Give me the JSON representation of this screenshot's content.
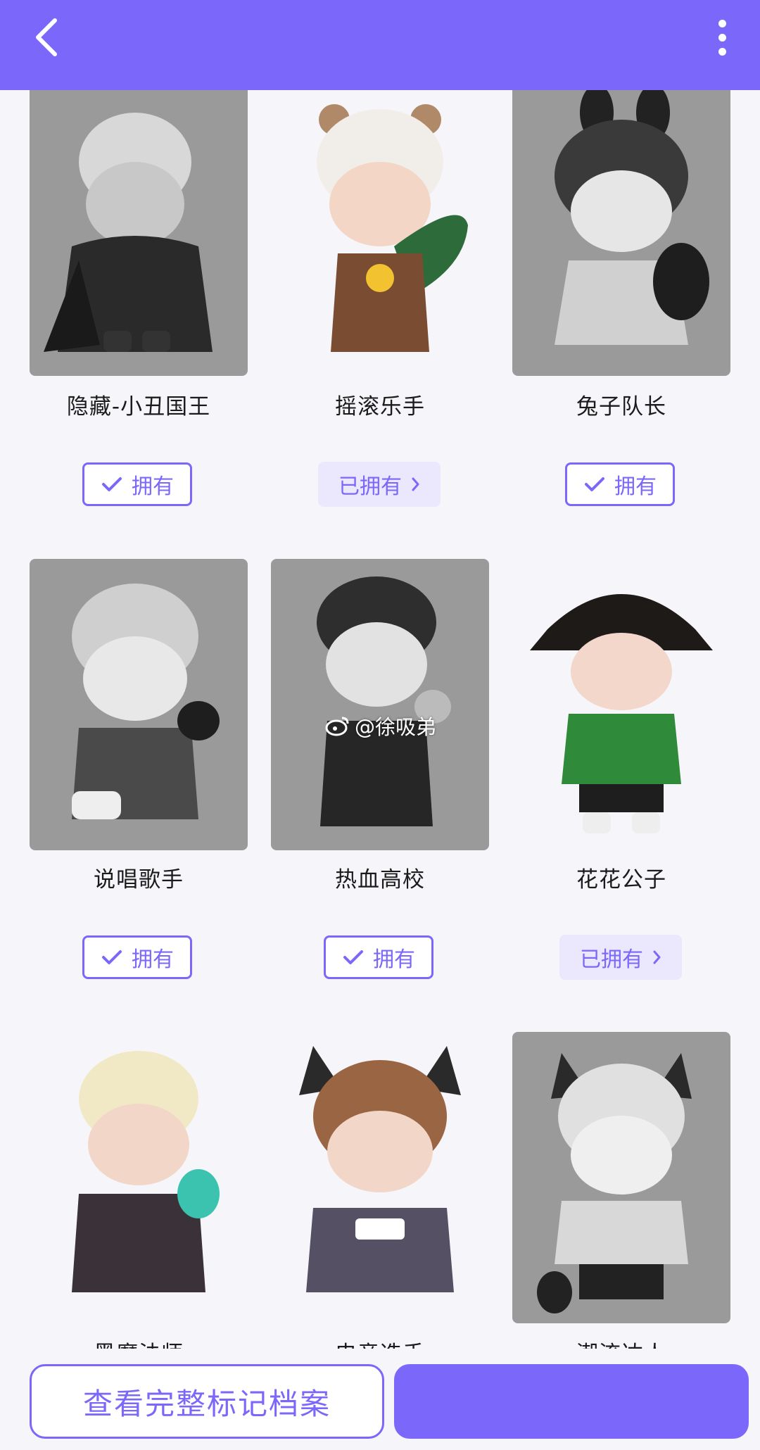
{
  "colors": {
    "accent": "#7b68fb",
    "own_bg": "#ffffff",
    "owned_bg": "#ebe8fd"
  },
  "header": {
    "back_icon": "chevron-left-icon",
    "more_icon": "more-vertical-icon"
  },
  "grid": {
    "items": [
      {
        "name": "隐藏-小丑国王",
        "status": "拥有",
        "image": "gray"
      },
      {
        "name": "摇滚乐手",
        "status": "已拥有",
        "image": "color"
      },
      {
        "name": "兔子队长",
        "status": "拥有",
        "image": "gray"
      },
      {
        "name": "说唱歌手",
        "status": "拥有",
        "image": "gray"
      },
      {
        "name": "热血高校",
        "status": "拥有",
        "image": "gray"
      },
      {
        "name": "花花公子",
        "status": "已拥有",
        "image": "color"
      },
      {
        "name": "黑魔法师",
        "image": "color"
      },
      {
        "name": "电竞选手",
        "image": "color"
      },
      {
        "name": "潮流达人",
        "image": "gray"
      }
    ]
  },
  "watermark": "@徐吸弟",
  "footer": {
    "archive_label": "查看完整标记档案"
  }
}
